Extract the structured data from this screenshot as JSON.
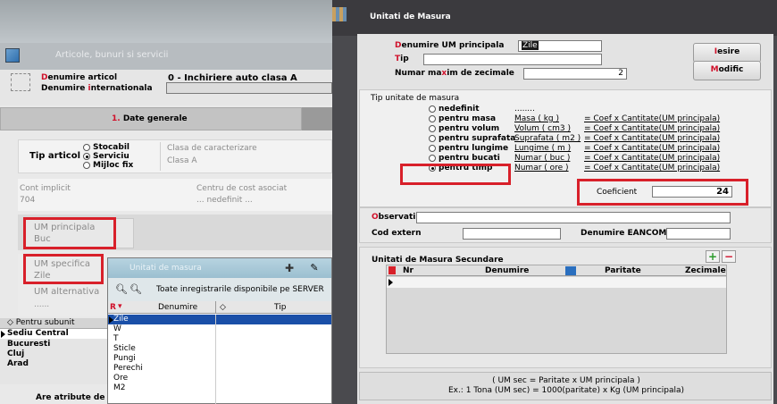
{
  "left": {
    "window_title": "Articole, bunuri si servicii",
    "denumire_articol_label_first": "D",
    "denumire_articol_label_rest": "enumire articol",
    "denumire_articol_value": "0 - Inchiriere auto clasa A",
    "denumire_int_label_a": "Denumire ",
    "denumire_int_label_i": "i",
    "denumire_int_label_b": "nternationala",
    "tab_number": "1.",
    "tab_label": " Date generale",
    "tip_articol_label": "Tip articol",
    "tip_options": [
      "Stocabil",
      "Serviciu",
      "Mijloc fix"
    ],
    "clasa_label": "Clasa de caracterizare",
    "clasa_value": "Clasa A",
    "cont_label": "Cont implicit",
    "cont_value": "704",
    "centru_label": "Centru de cost asociat",
    "centru_value": "... nedefinit ...",
    "um_principala_label": "UM principala",
    "um_principala_value": "Buc",
    "um_specifica_label": "UM specifica",
    "um_specifica_value": "Zile",
    "um_alternativa_label": "UM alternativa",
    "um_alternativa_value": "......",
    "subunit_header": "Pentru subunit",
    "subunits": [
      "Sediu Central",
      "Bucuresti",
      "Cluj",
      "Arad"
    ],
    "bottom_text": "Are atribute de"
  },
  "dropdown": {
    "title": "Unitati de masura",
    "filter_text": "Toate inregistrarile disponibile pe SERVER",
    "col_marker": "R",
    "col_denumire": "Denumire",
    "col_tip": "Tip",
    "rows": [
      "Zile",
      "W",
      "T",
      "Sticle",
      "Pungi",
      "Perechi",
      "Ore",
      "M2"
    ]
  },
  "dialog": {
    "title": "Unitati de Masura",
    "denumire_um_label_first": "D",
    "denumire_um_label_rest": "enumire UM principala",
    "denumire_um_value": "Zile",
    "tip_label_first": "T",
    "tip_label_rest": "ip",
    "tip_value": "",
    "zecimale_label_a": "Numar ma",
    "zecimale_label_x": "x",
    "zecimale_label_b": "im de zecimale",
    "zecimale_value": "2",
    "iesire_first": "I",
    "iesire_rest": "esire",
    "modific_first": "M",
    "modific_rest": "odific",
    "tip_unitate_label": "Tip unitate de masura",
    "types": [
      {
        "label": "nedefinit",
        "unit": "........",
        "formula": "",
        "selected": false
      },
      {
        "label": "pentru masa",
        "unit": "Masa ( kg )",
        "formula": "= Coef x Cantitate(UM principala)",
        "selected": false
      },
      {
        "label": "pentru volum",
        "unit": "Volum ( cm3 )",
        "formula": "= Coef x Cantitate(UM principala)",
        "selected": false
      },
      {
        "label": "pentru suprafata",
        "unit": "Suprafata ( m2 )",
        "formula": "= Coef x Cantitate(UM principala)",
        "selected": false
      },
      {
        "label": "pentru lungime",
        "unit": "Lungime ( m )",
        "formula": "= Coef x Cantitate(UM principala)",
        "selected": false
      },
      {
        "label": "pentru bucati",
        "unit": "Numar ( buc )",
        "formula": "= Coef x Cantitate(UM principala)",
        "selected": false
      },
      {
        "label": "pentru timp",
        "unit": "Numar ( ore )",
        "formula": "= Coef x Cantitate(UM principala)",
        "selected": true
      }
    ],
    "coeficient_label": "Coeficient",
    "coeficient_value": "24",
    "observatii_first": "O",
    "observatii_rest": "bservatii",
    "observatii_value": "",
    "cod_extern_label": "Cod extern",
    "cod_extern_value": "",
    "eancom_label": "Denumire EANCOM",
    "eancom_value": "",
    "sec_title": "Unitati de Masura Secundare",
    "sec_cols": [
      "Nr",
      "Denumire",
      "Paritate",
      "Zecimale"
    ],
    "note_line1": "( UM sec = Paritate x UM principala )",
    "note_line2": "Ex.: 1 Tona (UM sec) = 1000(paritate) x Kg (UM principala)"
  },
  "colors": {
    "accent_red": "#d0102a",
    "dialog_bg": "#3b3a3e",
    "selection_blue": "#1a4fa8"
  }
}
